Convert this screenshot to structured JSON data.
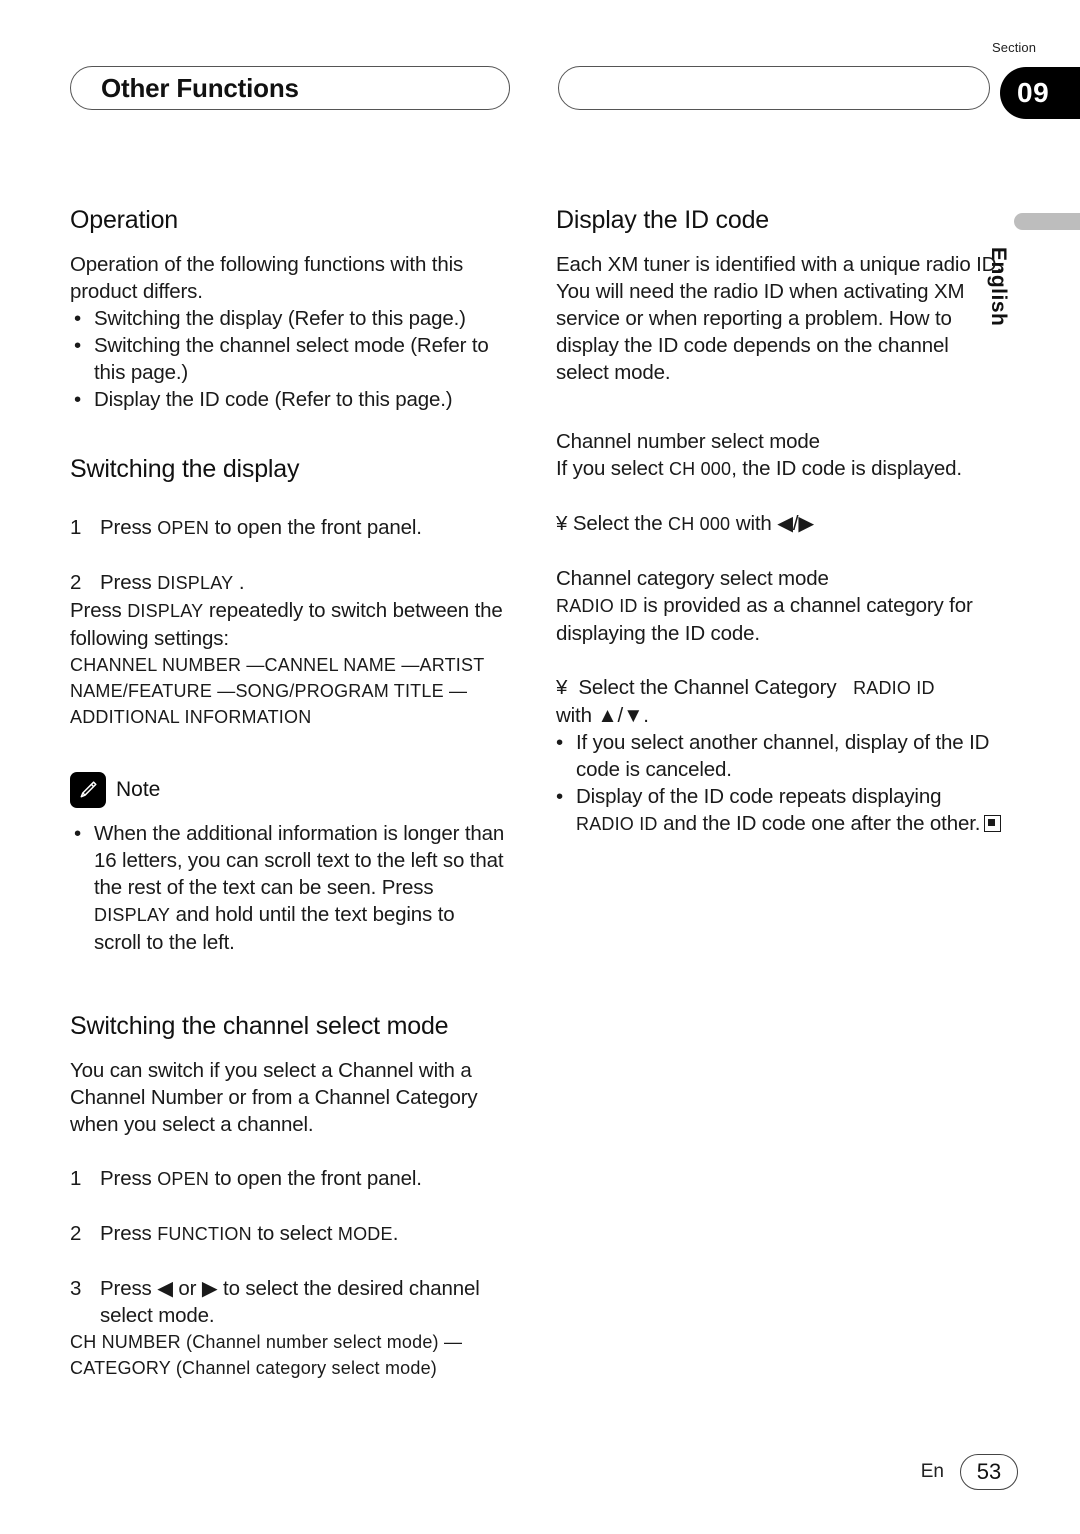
{
  "header": {
    "title": "Other Functions",
    "secondary_title": "",
    "section_label": "Section",
    "section_number": "09"
  },
  "side_tab": {
    "language": "English"
  },
  "left_column": {
    "operation": {
      "heading": "Operation",
      "intro": "Operation of the following functions with this product differs.",
      "bullets": [
        "Switching the display (Refer to this page.)",
        "Switching the channel select mode (Refer to this page.)",
        "Display the ID code (Refer to this page.)"
      ]
    },
    "switching_display": {
      "heading": "Switching the display",
      "step1_num": "1",
      "step1_text_a": "Press",
      "step1_key": "OPEN",
      "step1_text_b": "to open the front panel.",
      "step2_num": "2",
      "step2_text_a": "Press",
      "step2_key": "DISPLAY",
      "step2_text_b": ".",
      "step2_cont_a": "Press",
      "step2_cont_key": "DISPLAY",
      "step2_cont_b": "repeatedly to switch between the following settings:",
      "settings_chain": "CHANNEL NUMBER —CANNEL NAME —ARTIST NAME/FEATURE —SONG/PROGRAM TITLE — ADDITIONAL INFORMATION"
    },
    "note": {
      "icon": "pencil-icon",
      "label": "Note",
      "bullet_a": "When the additional information is longer than 16 letters, you can scroll text to the left so that the rest of the text can be seen. Press",
      "bullet_key": "DISPLAY",
      "bullet_b": "and hold until the text begins to scroll to the left."
    },
    "switching_channel_mode": {
      "heading": "Switching the channel select mode",
      "intro": "You can switch if you select a Channel with a Channel Number or from a Channel Category when you select a channel.",
      "step1_num": "1",
      "step1_text_a": "Press",
      "step1_key": "OPEN",
      "step1_text_b": "to open the front panel.",
      "step2_num": "2",
      "step2_text_a": "Press",
      "step2_key": "FUNCTION",
      "step2_text_b": "to select",
      "step2_key2": "MODE",
      "step2_text_c": ".",
      "step3_num": "3",
      "step3_text_a": "Press",
      "step3_arrow_left": "◀",
      "step3_text_or": "or",
      "step3_arrow_right": "▶",
      "step3_text_b": "to select the desired channel select mode.",
      "mode_line1_key": "CH NUMBER",
      "mode_line1_text": "(Channel number select mode) —",
      "mode_line2_key": "CATEGORY",
      "mode_line2_text": "(Channel category select mode)"
    }
  },
  "right_column": {
    "display_id_code": {
      "heading": "Display the ID code",
      "intro": "Each XM tuner is identified with a unique radio ID. You will need the radio ID when activating XM service or when reporting a problem. How to display the ID code depends on the channel select mode.",
      "num_mode_heading": "Channel number select mode",
      "num_mode_text_a": "If you select",
      "num_mode_key": "CH 000",
      "num_mode_text_b": ", the ID code is displayed.",
      "num_mode_action_marker": "¥",
      "num_mode_action_a": "Select the",
      "num_mode_action_key": "CH 000",
      "num_mode_action_b": "with",
      "num_mode_action_arrows": "◀/▶",
      "cat_mode_heading": "Channel category select mode",
      "cat_mode_key": "RADIO ID",
      "cat_mode_text": "is provided as a channel category for displaying the ID code.",
      "cat_action_marker": "¥",
      "cat_action_a": "Select the Channel Category",
      "cat_action_key": "RADIO ID",
      "cat_action_b": "with",
      "cat_action_arrows": "▲/▼",
      "cat_action_c": ".",
      "bullet1": "If you select another channel, display of the ID code is canceled.",
      "bullet2": "Display of the ID code repeats displaying",
      "bullet2_key": "RADIO ID",
      "bullet2_cont": "and the ID code one after the other."
    }
  },
  "footer": {
    "language": "En",
    "page_number": "53"
  }
}
